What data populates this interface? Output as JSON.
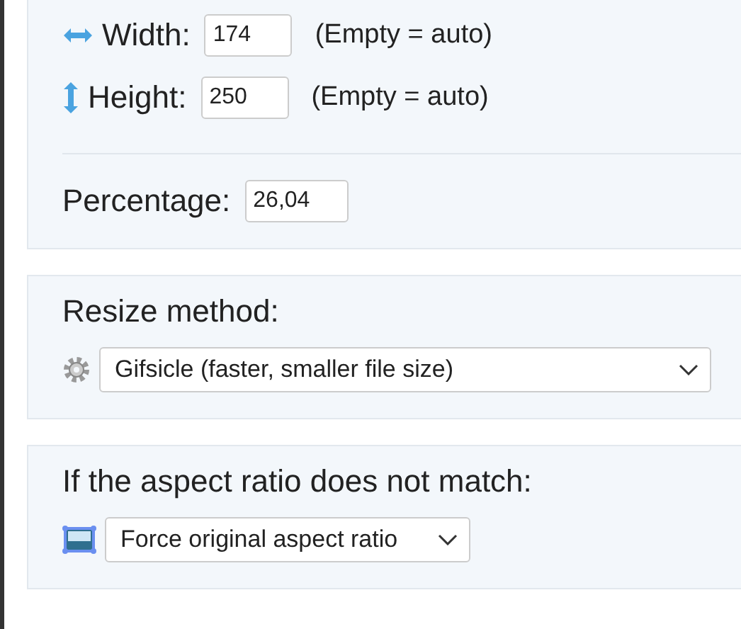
{
  "dimensions": {
    "width": {
      "label": "Width:",
      "value": "174",
      "hint": "(Empty = auto)"
    },
    "height": {
      "label": "Height:",
      "value": "250",
      "hint": "(Empty = auto)"
    },
    "percentage": {
      "label": "Percentage:",
      "value": "26,04"
    }
  },
  "resize_method": {
    "label": "Resize method:",
    "value": "Gifsicle (faster, smaller file size)"
  },
  "aspect_ratio": {
    "label": "If the aspect ratio does not match:",
    "value": "Force original aspect ratio"
  }
}
